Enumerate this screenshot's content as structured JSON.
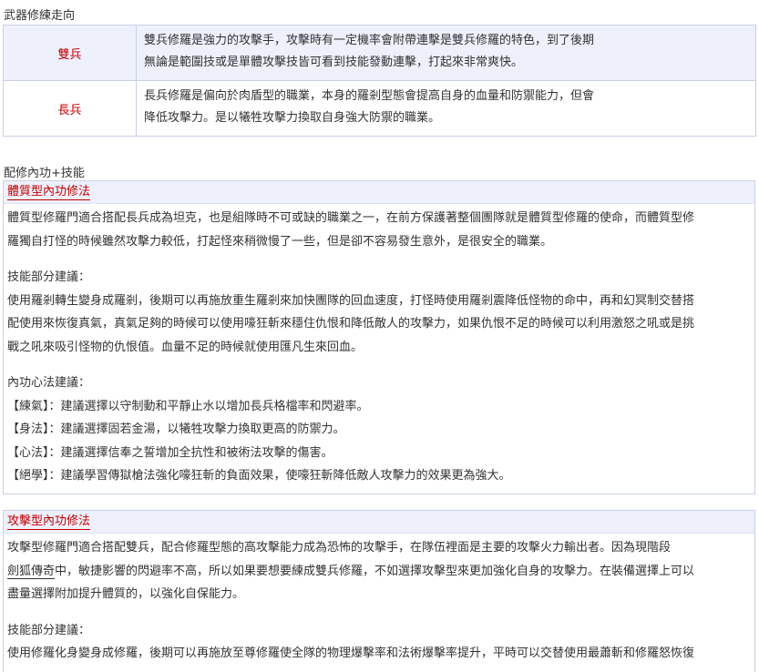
{
  "weapons_section": {
    "title": "武器修練走向",
    "rows": [
      {
        "name": "雙兵",
        "lines": [
          "雙兵修羅是強力的攻擊手，攻擊時有一定機率會附帶連擊是雙兵修羅的特色，到了後期",
          "無論是範圍技或是單體攻擊技皆可看到技能發動連擊，打起來非常爽快。"
        ]
      },
      {
        "name": "長兵",
        "lines": [
          "長兵修羅是偏向於肉盾型的職業，本身的羅剎型態會提高自身的血量和防禦能力，但會",
          "降低攻擊力。是以犧牲攻擊力換取自身強大防禦的職業。"
        ]
      }
    ]
  },
  "skills_section": {
    "title": "配修內功+技能",
    "body_box": {
      "heading": "體質型內功修法",
      "intro": [
        "體質型修羅門適合搭配長兵成為坦克，也是組隊時不可或缺的職業之一，在前方保護著整個團隊就是體質型修羅的使命，而體質型修",
        "羅獨自打怪的時候雖然攻擊力較低，打起怪來稍微慢了一些，但是卻不容易發生意外，是很安全的職業。"
      ],
      "skills_label": "技能部分建議：",
      "skills": [
        "使用羅剎轉生變身成羅剎，後期可以再施放重生羅剎來加快團隊的回血速度，打怪時使用羅剎震降低怪物的命中，再和幻冥制交替搭",
        "配使用來恢復真氣，真氣足夠的時候可以使用嚎狂斬來穩住仇恨和降低敵人的攻擊力，如果仇恨不足的時候可以利用激怒之吼或是挑",
        "戰之吼來吸引怪物的仇恨值。血量不足的時候就使用匯凡生來回血。"
      ],
      "inner_label": "內功心法建議：",
      "inner": [
        {
          "tag": "【練氣】",
          "text": "：建議選擇以守制動和平靜止水以增加長兵格檔率和閃避率。"
        },
        {
          "tag": "【身法】",
          "text": "：建議選擇固若金湯，以犧牲攻擊力換取更高的防禦力。"
        },
        {
          "tag": "【心法】",
          "text": "：建議選擇信奉之誓增加全抗性和被術法攻擊的傷害。"
        },
        {
          "tag": "【絕學】",
          "text": "：建議學習傳獄槍法強化嚎狂斬的負面效果，使嚎狂斬降低敵人攻擊力的效果更為強大。"
        }
      ]
    },
    "attack_box": {
      "heading": "攻擊型內功修法",
      "intro_line1": "攻擊型修羅門適合搭配雙兵，配合修羅型態的高攻擊能力成為恐怖的攻擊手，在隊伍裡面是主要的攻擊火力輸出者。因為現階段",
      "intro_link": "劍狐傳奇",
      "intro_line2_rest": "中，敏捷影響的閃避率不高，所以如果要想要練成雙兵修羅，不如選擇攻擊型來更加強化自身的攻擊力。在裝備選擇上可以",
      "intro_line3": "盡量選擇附加提升體質的，以強化自保能力。",
      "skills_label": "技能部分建議：",
      "skills": [
        "使用修羅化身變身成修羅，後期可以再施放至尊修羅使全隊的物理爆擊率和法術爆擊率提升，平時可以交替使用最蕭斬和修羅怒恢復"
      ]
    }
  }
}
